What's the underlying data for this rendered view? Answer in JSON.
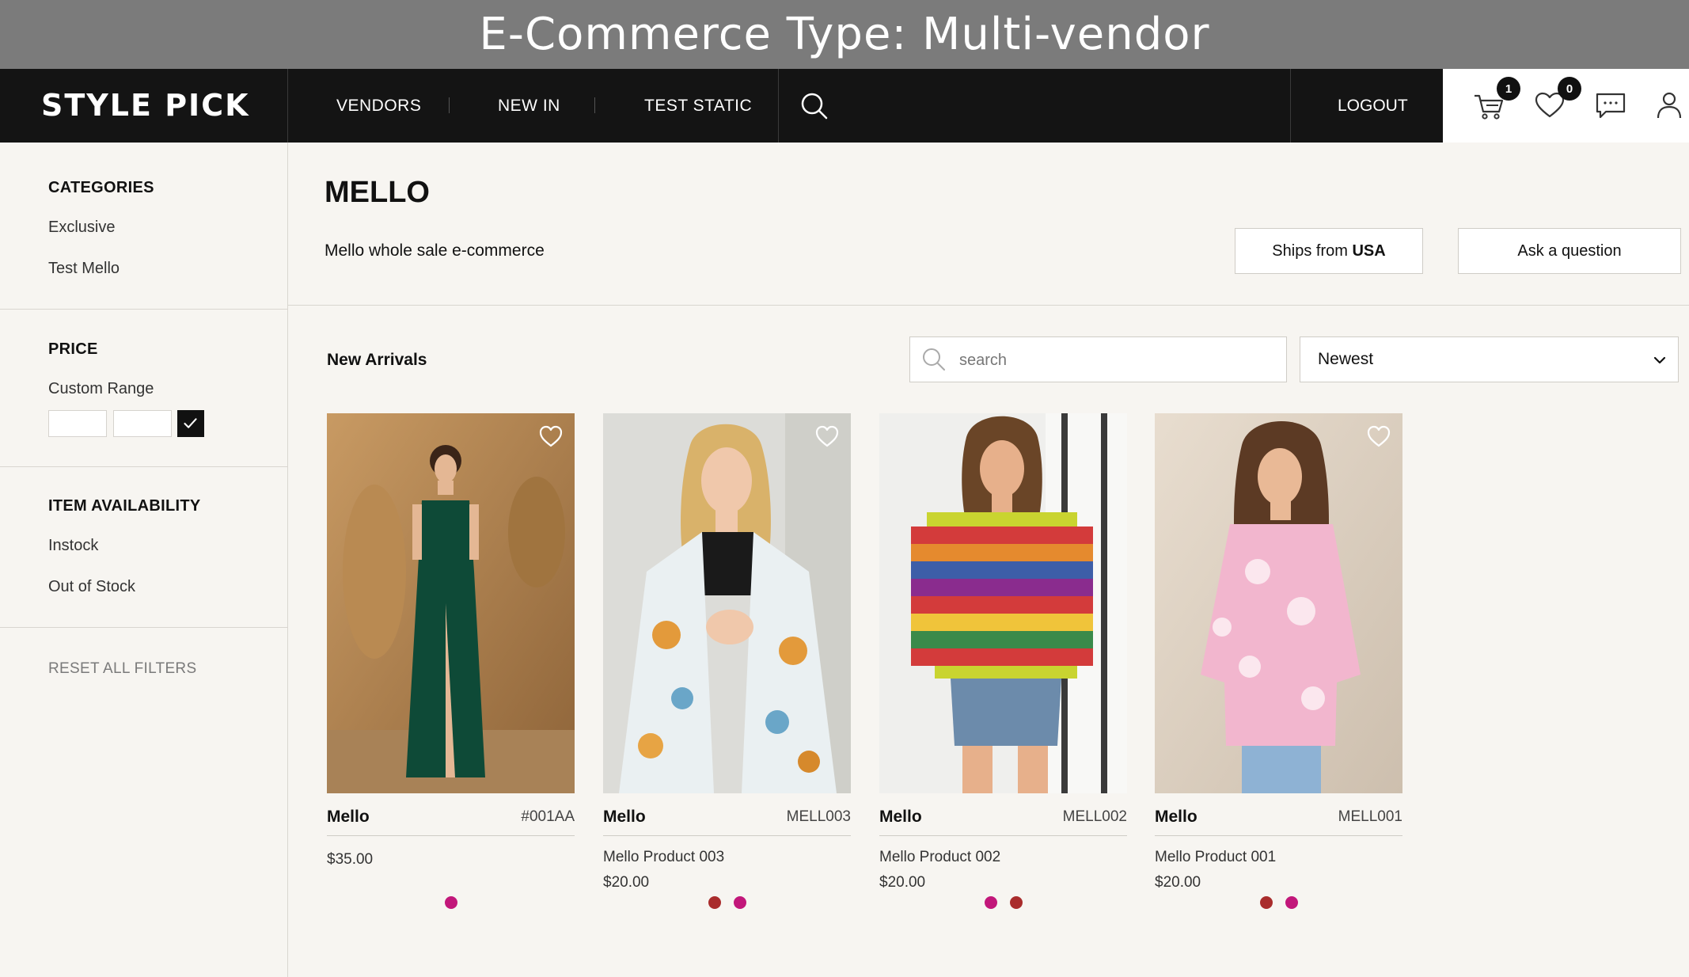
{
  "banner": {
    "title": "E-Commerce Type: Multi-vendor"
  },
  "nav": {
    "logo": "STYLE PICK",
    "items": [
      "VENDORS",
      "NEW IN",
      "TEST STATIC"
    ],
    "logout": "LOGOUT",
    "cart_count": "1",
    "wishlist_count": "0",
    "icons": [
      "search-icon",
      "cart-icon",
      "heart-icon",
      "chat-icon",
      "user-icon"
    ]
  },
  "sidebar": {
    "categories_title": "CATEGORIES",
    "categories": [
      "Exclusive",
      "Test Mello"
    ],
    "price_title": "PRICE",
    "custom_range_label": "Custom Range",
    "availability_title": "ITEM AVAILABILITY",
    "availability": [
      "Instock",
      "Out of Stock"
    ],
    "reset_label": "RESET ALL FILTERS"
  },
  "store": {
    "name": "MELLO",
    "description": "Mello whole sale e-commerce",
    "ships_prefix": "Ships from ",
    "ships_country": "USA",
    "ask_label": "Ask a question"
  },
  "listing": {
    "section_title": "New Arrivals",
    "search_placeholder": "search",
    "sort_value": "Newest"
  },
  "products": [
    {
      "brand": "Mello",
      "sku": "#001AA",
      "name": "",
      "price": "$35.00",
      "swatches": [
        "#c2177a"
      ]
    },
    {
      "brand": "Mello",
      "sku": "MELL003",
      "name": "Mello Product 003",
      "price": "$20.00",
      "swatches": [
        "#a92c2c",
        "#c2177a"
      ]
    },
    {
      "brand": "Mello",
      "sku": "MELL002",
      "name": "Mello Product 002",
      "price": "$20.00",
      "swatches": [
        "#c2177a",
        "#a92c2c"
      ]
    },
    {
      "brand": "Mello",
      "sku": "MELL001",
      "name": "Mello Product 001",
      "price": "$20.00",
      "swatches": [
        "#a92c2c",
        "#c2177a"
      ]
    }
  ],
  "colors": {
    "dark": "#141414",
    "background": "#f7f5f1",
    "magenta": "#c2177a",
    "maroon": "#a92c2c"
  }
}
